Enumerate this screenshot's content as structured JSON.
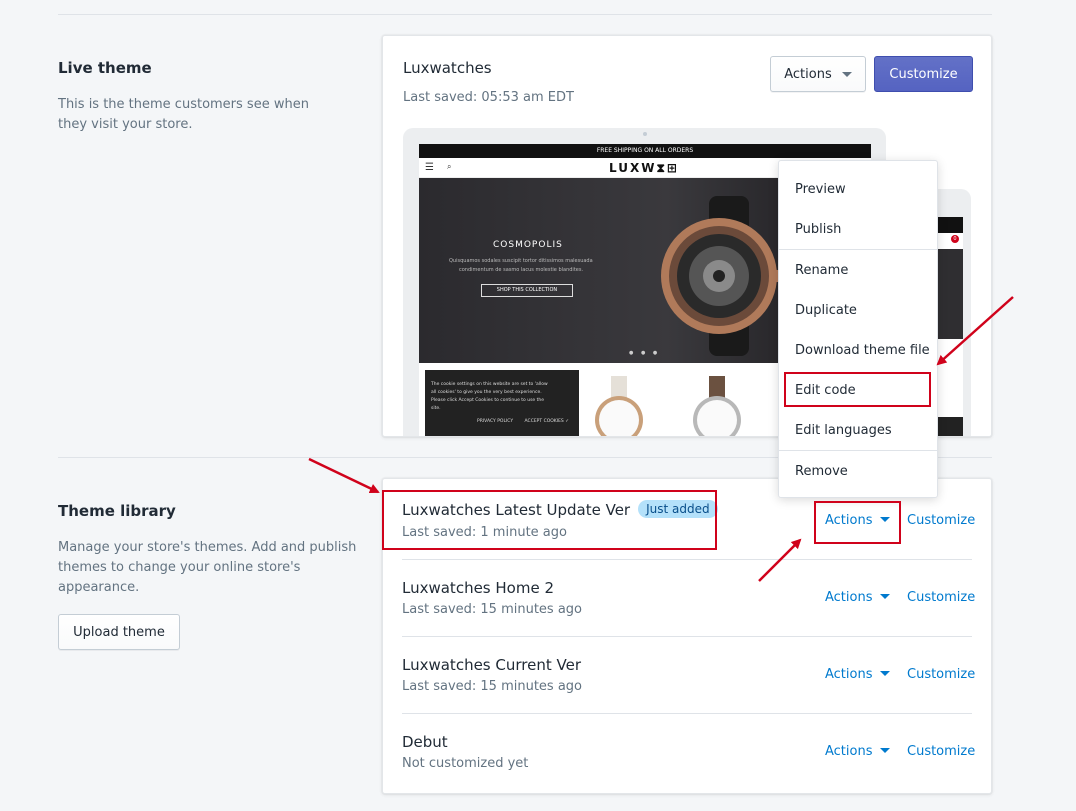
{
  "live_theme": {
    "section_title": "Live theme",
    "section_desc": "This is the theme customers see when they visit your store.",
    "theme_name": "Luxwatches",
    "last_saved": "Last saved: 05:53 am EDT",
    "actions_label": "Actions",
    "customize_label": "Customize"
  },
  "preview": {
    "banner": "FREE SHIPPING ON ALL ORDERS",
    "logo": "LUXW⧗⊞",
    "hero_title": "COSMOPOLIS",
    "hero_text_1": "Quisquamos sodales suscipit tortor ditissimos malesuada",
    "hero_text_2": "condimentum de sasmo lacus molestie blandites.",
    "hero_button": "SHOP THIS COLLECTION",
    "cookie_text_1": "The cookie settings on this website are set to 'allow",
    "cookie_text_2": "all cookies' to give you the very best experience.",
    "cookie_text_3": "Please click Accept Cookies to continue to use the",
    "cookie_text_4": "site.",
    "privacy": "PRIVACY POLICY",
    "accept": "ACCEPT COOKIES ✓",
    "cart_count": "0"
  },
  "actions_menu": {
    "items": [
      "Preview",
      "Publish",
      "Rename",
      "Duplicate",
      "Download theme file",
      "Edit code",
      "Edit languages",
      "Remove"
    ]
  },
  "theme_library": {
    "section_title": "Theme library",
    "section_desc": "Manage your store's themes. Add and publish themes to change your online store's appearance.",
    "upload_label": "Upload theme",
    "themes": [
      {
        "name": "Luxwatches Latest Update Ver",
        "badge": "Just added",
        "saved": "Last saved: 1 minute ago",
        "actions": "Actions",
        "customize": "Customize"
      },
      {
        "name": "Luxwatches Home 2",
        "saved": "Last saved: 15 minutes ago",
        "actions": "Actions",
        "customize": "Customize"
      },
      {
        "name": "Luxwatches Current Ver",
        "saved": "Last saved: 15 minutes ago",
        "actions": "Actions",
        "customize": "Customize"
      },
      {
        "name": "Debut",
        "saved": "Not customized yet",
        "actions": "Actions",
        "customize": "Customize"
      }
    ]
  },
  "colors": {
    "primary": "#5c6ac4",
    "link": "#007ace",
    "annotation_red": "#d0021b",
    "badge_bg": "#b4e1fa"
  }
}
